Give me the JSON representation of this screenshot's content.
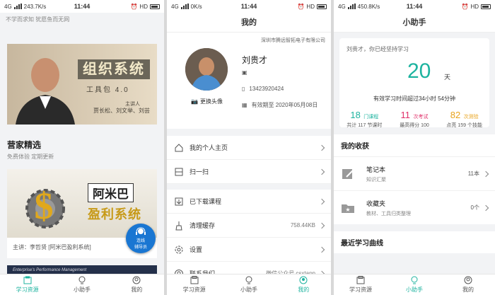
{
  "colors": {
    "accent": "#1db39f",
    "course": "#1db39f",
    "exam": "#e0306a",
    "test": "#e8a21a",
    "fab": "#1976d2"
  },
  "panel1": {
    "status": {
      "signal": "4G",
      "speed": "243.7K/s",
      "time": "11:44",
      "right": "HD"
    },
    "slogan": "不学而求知 犹愿鱼而无网",
    "banner": {
      "title": "组织系统",
      "subtitle": "工具包 4.0",
      "lecturer_label": "主讲人",
      "lecturers": "贾长松、刘文举、刘芸"
    },
    "section_title": "营家精选",
    "section_sub": "免费体验 定期更新",
    "card": {
      "title_a": "阿米巴",
      "title_b": "盈利系统",
      "lecturer": "主讲：李哲贤 [阿米巴盈利系统]"
    },
    "fab": {
      "line1": "连线",
      "line2": "辅导员"
    },
    "card3_text": "Enterprise's Performance Management"
  },
  "panel2": {
    "status": {
      "signal": "4G",
      "speed": "0K/s",
      "time": "11:44",
      "right": "HD"
    },
    "title": "我的",
    "org": "深圳市腾远智拓电子有限公司",
    "name": "刘贵才",
    "phone": "13423920424",
    "expiry": "有效期至 2020年05月08日",
    "change_avatar": "更换头像",
    "menu": [
      {
        "label": "我的个人主页",
        "value": ""
      },
      {
        "label": "扫一扫",
        "value": ""
      },
      {
        "label": "已下载课程",
        "value": ""
      },
      {
        "label": "清理缓存",
        "value": "758.44KB"
      },
      {
        "label": "设置",
        "value": ""
      },
      {
        "label": "联系我们",
        "value": "微信公众号 csxtapp"
      }
    ]
  },
  "panel3": {
    "status": {
      "signal": "4G",
      "speed": "450.8K/s",
      "time": "11:44",
      "right": "HD"
    },
    "title": "小助手",
    "greeting": "刘贵才，你已经坚持学习",
    "days": "20",
    "days_unit": "天",
    "effective": "有效学习时间超过34小时 54分钟",
    "stats": [
      {
        "num": "18",
        "unit": "门课程",
        "desc": "共计 117 节课时"
      },
      {
        "num": "11",
        "unit": "次考试",
        "desc": "最高得分 100"
      },
      {
        "num": "82",
        "unit": "次测验",
        "desc": "点亮 159 个技能"
      }
    ],
    "fav_title": "我的收获",
    "favorites": [
      {
        "title": "笔记本",
        "desc": "知识汇聚",
        "count": "11本"
      },
      {
        "title": "收藏夹",
        "desc": "教材、工具归类整理",
        "count": "0个"
      }
    ],
    "curve_title": "最近学习曲线"
  },
  "tabs": [
    "学习资源",
    "小助手",
    "我的"
  ]
}
